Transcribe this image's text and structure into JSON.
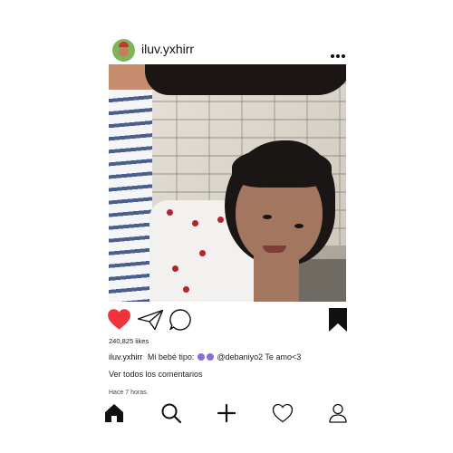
{
  "post": {
    "username": "iluv.yxhirr",
    "likes": "240,825 likes",
    "caption_user": "iluv.yxhirr",
    "caption_text_before": "Mi bebé tipo:",
    "caption_text_after": "@debaniyo2 Te amo<3",
    "view_comments": "Ver todos los comentarios",
    "time_ago": "Hace 7 horas."
  },
  "icons": {
    "header": [
      "avatar",
      "more-options-icon"
    ],
    "actions": [
      "heart-icon",
      "share-icon",
      "comment-icon",
      "bookmark-icon"
    ],
    "nav": [
      "home-icon",
      "search-icon",
      "add-icon",
      "activity-heart-icon",
      "profile-icon"
    ]
  },
  "colors": {
    "like": "#f0343b",
    "text": "#111111",
    "emoji": "#8e6bd6"
  }
}
